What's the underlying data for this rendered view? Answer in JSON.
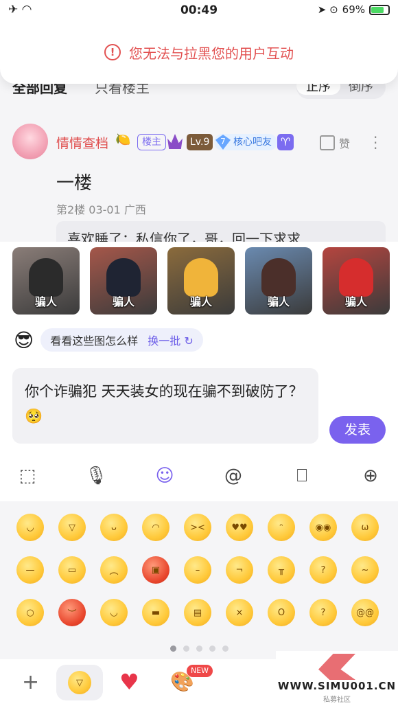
{
  "status_bar": {
    "time": "00:49",
    "battery": "69%",
    "left_icons": "✈ ◠",
    "right_icons": "➤ ⊙"
  },
  "toast": {
    "message": "您无法与拉黑您的用户互动"
  },
  "tabs": {
    "all": "全部回复",
    "owner_only": "只看楼主",
    "asc": "正序",
    "desc": "倒序"
  },
  "post": {
    "username": "情情查档",
    "badge_owner": "楼主",
    "level": "Lv.9",
    "core_num": "7",
    "core_label": "核心吧友",
    "zodiac": "♈",
    "like_label": "赞",
    "content": "一楼",
    "meta": "第2楼   03-01   广西",
    "reply_preview": "喜欢睡了：私信你了，哥，回一下求求"
  },
  "stickers": [
    {
      "caption": "骗人",
      "bg": "#8a7d78",
      "fig": "#2b2b2b"
    },
    {
      "caption": "骗人",
      "bg": "#a5574a",
      "fig": "#1f2433"
    },
    {
      "caption": "骗人",
      "bg": "#8b6b3c",
      "fig": "#f0b43a"
    },
    {
      "caption": "骗人",
      "bg": "#6a8ab0",
      "fig": "#4b2f2a"
    },
    {
      "caption": "骗人",
      "bg": "#b5453f",
      "fig": "#d62d2d"
    }
  ],
  "suggest": {
    "text": "看看这些图怎么样",
    "swap": "换一批"
  },
  "input": {
    "text": "你个诈骗犯 天天装女的现在骗不到破防了？ 🥺"
  },
  "send_label": "发表",
  "watermark": {
    "url": "WWW.SIMU001.CN",
    "sub": "私募社区"
  },
  "bottom": {
    "new_badge": "NEW"
  }
}
